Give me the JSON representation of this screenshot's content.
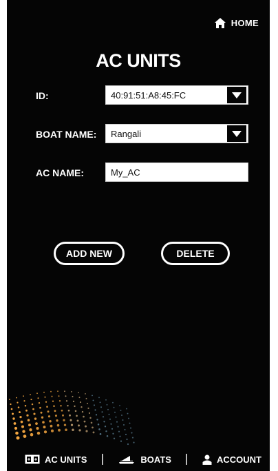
{
  "header": {
    "home_label": "HOME",
    "home_icon": "home-icon"
  },
  "page": {
    "title": "AC UNITS"
  },
  "form": {
    "id_label": "ID:",
    "id_value": "40:91:51:A8:45:FC",
    "boat_label": "BOAT NAME:",
    "boat_value": "Rangali",
    "ac_label": "AC NAME:",
    "ac_value": "My_AC"
  },
  "actions": {
    "add_label": "ADD NEW",
    "delete_label": "DELETE"
  },
  "tabbar": {
    "ac_units": "AC UNITS",
    "boats": "BOATS",
    "account": "ACCOUNT"
  },
  "colors": {
    "background": "#050505",
    "text": "#ffffff"
  }
}
